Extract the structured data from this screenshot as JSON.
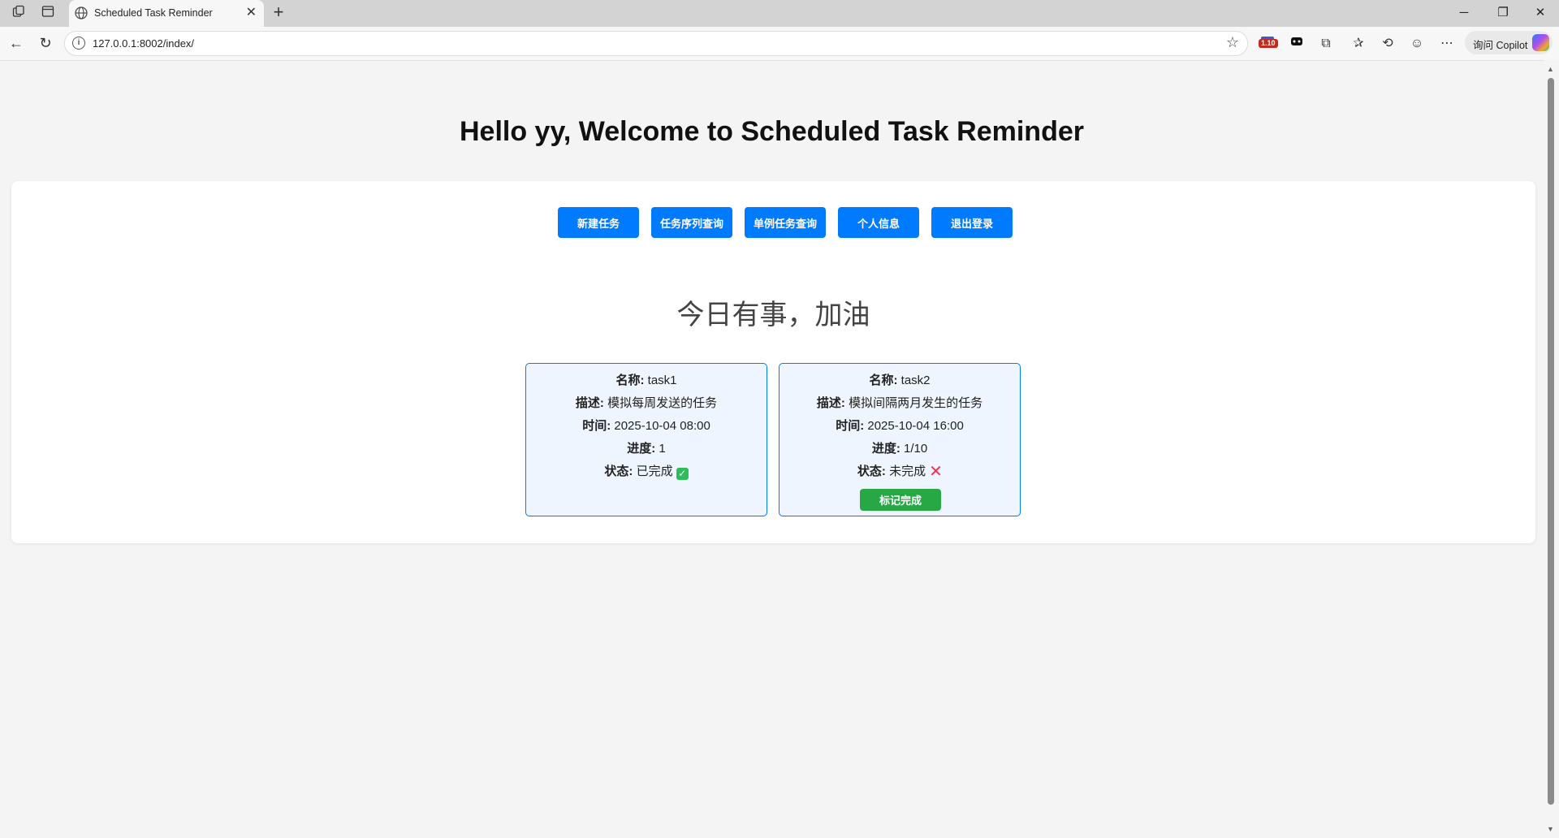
{
  "browser": {
    "tab_title": "Scheduled Task Reminder",
    "url": "127.0.0.1:8002/index/",
    "extension_badge": "1.10",
    "copilot_label": "询问 Copilot"
  },
  "page": {
    "greeting": "Hello yy, Welcome to Scheduled Task Reminder",
    "actions": [
      "新建任务",
      "任务序列查询",
      "单例任务查询",
      "个人信息",
      "退出登录"
    ],
    "today_heading": "今日有事，加油"
  },
  "labels": {
    "name": "名称:",
    "description": "描述:",
    "time": "时间:",
    "progress": "进度:",
    "status": "状态:"
  },
  "tasks": [
    {
      "name": "task1",
      "description": "模拟每周发送的任务",
      "time": "2025-10-04 08:00",
      "progress": "1",
      "status": "已完成",
      "status_icon": "check-mark-icon"
    },
    {
      "name": "task2",
      "description": "模拟间隔两月发生的任务",
      "time": "2025-10-04 16:00",
      "progress": "1/10",
      "status": "未完成",
      "status_icon": "cross-mark-icon",
      "mark_button": "标记完成"
    }
  ],
  "colors": {
    "primary": "#007bff",
    "success": "#28a745",
    "card_bg": "#eef5ff",
    "page_bg": "#f4f4f4"
  }
}
